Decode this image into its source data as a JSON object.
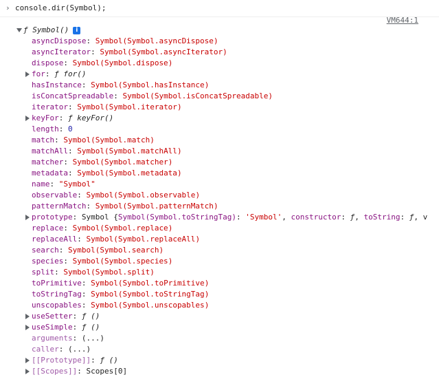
{
  "console": {
    "input": "console.dir(Symbol);",
    "source_link": "VM644:1"
  },
  "root": {
    "label": "ƒ Symbol()",
    "info_icon": "i"
  },
  "properties": [
    {
      "key": "asyncDispose",
      "value": "Symbol(Symbol.asyncDispose)",
      "kind": "symbol",
      "expandable": false
    },
    {
      "key": "asyncIterator",
      "value": "Symbol(Symbol.asyncIterator)",
      "kind": "symbol",
      "expandable": false
    },
    {
      "key": "dispose",
      "value": "Symbol(Symbol.dispose)",
      "kind": "symbol",
      "expandable": false
    },
    {
      "key": "for",
      "value": "ƒ for()",
      "kind": "fn",
      "expandable": true
    },
    {
      "key": "hasInstance",
      "value": "Symbol(Symbol.hasInstance)",
      "kind": "symbol",
      "expandable": false
    },
    {
      "key": "isConcatSpreadable",
      "value": "Symbol(Symbol.isConcatSpreadable)",
      "kind": "symbol",
      "expandable": false
    },
    {
      "key": "iterator",
      "value": "Symbol(Symbol.iterator)",
      "kind": "symbol",
      "expandable": false
    },
    {
      "key": "keyFor",
      "value": "ƒ keyFor()",
      "kind": "fn",
      "expandable": true
    },
    {
      "key": "length",
      "value": "0",
      "kind": "num",
      "expandable": false
    },
    {
      "key": "match",
      "value": "Symbol(Symbol.match)",
      "kind": "symbol",
      "expandable": false
    },
    {
      "key": "matchAll",
      "value": "Symbol(Symbol.matchAll)",
      "kind": "symbol",
      "expandable": false
    },
    {
      "key": "matcher",
      "value": "Symbol(Symbol.matcher)",
      "kind": "symbol",
      "expandable": false
    },
    {
      "key": "metadata",
      "value": "Symbol(Symbol.metadata)",
      "kind": "symbol",
      "expandable": false
    },
    {
      "key": "name",
      "value": "\"Symbol\"",
      "kind": "str",
      "expandable": false
    },
    {
      "key": "observable",
      "value": "Symbol(Symbol.observable)",
      "kind": "symbol",
      "expandable": false
    },
    {
      "key": "patternMatch",
      "value": "Symbol(Symbol.patternMatch)",
      "kind": "symbol",
      "expandable": false
    },
    {
      "key": "prototype",
      "value": "Symbol {Symbol(Symbol.toStringTag): 'Symbol', constructor: ƒ, toString: ƒ, v",
      "kind": "proto",
      "expandable": true
    },
    {
      "key": "replace",
      "value": "Symbol(Symbol.replace)",
      "kind": "symbol",
      "expandable": false
    },
    {
      "key": "replaceAll",
      "value": "Symbol(Symbol.replaceAll)",
      "kind": "symbol",
      "expandable": false
    },
    {
      "key": "search",
      "value": "Symbol(Symbol.search)",
      "kind": "symbol",
      "expandable": false
    },
    {
      "key": "species",
      "value": "Symbol(Symbol.species)",
      "kind": "symbol",
      "expandable": false
    },
    {
      "key": "split",
      "value": "Symbol(Symbol.split)",
      "kind": "symbol",
      "expandable": false
    },
    {
      "key": "toPrimitive",
      "value": "Symbol(Symbol.toPrimitive)",
      "kind": "symbol",
      "expandable": false
    },
    {
      "key": "toStringTag",
      "value": "Symbol(Symbol.toStringTag)",
      "kind": "symbol",
      "expandable": false
    },
    {
      "key": "unscopables",
      "value": "Symbol(Symbol.unscopables)",
      "kind": "symbol",
      "expandable": false
    },
    {
      "key": "useSetter",
      "value": "ƒ ()",
      "kind": "fn",
      "expandable": true
    },
    {
      "key": "useSimple",
      "value": "ƒ ()",
      "kind": "fn",
      "expandable": true
    },
    {
      "key": "arguments",
      "value": "(...)",
      "kind": "lazy",
      "expandable": false
    },
    {
      "key": "caller",
      "value": "(...)",
      "kind": "lazy",
      "expandable": false
    },
    {
      "key": "[[Prototype]]",
      "value": "ƒ ()",
      "kind": "fn",
      "expandable": true
    },
    {
      "key": "[[Scopes]]",
      "value": "Scopes[0]",
      "kind": "plain",
      "expandable": true
    }
  ],
  "colors": {
    "key": "#881280",
    "key_dim": "#a05aa8",
    "symbol_paren": "#c80000",
    "number": "#1a1aa6",
    "string": "#c80000"
  },
  "icons": {
    "prompt": "chevron-right-icon",
    "expand_open": "triangle-down-icon",
    "expand_closed": "triangle-right-icon",
    "info": "info-icon"
  }
}
